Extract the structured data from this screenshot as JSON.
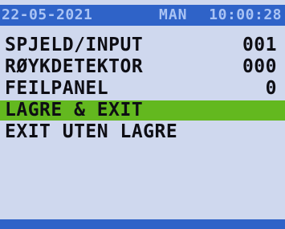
{
  "status_bar": {
    "date": "22-05-2021",
    "day": "MAN",
    "time": "10:00:28"
  },
  "menu": {
    "items": [
      {
        "label": "SPJELD/INPUT",
        "value": "001",
        "selected": false
      },
      {
        "label": "RØYKDETEKTOR",
        "value": "000",
        "selected": false
      },
      {
        "label": "FEILPANEL",
        "value": "0",
        "selected": false
      },
      {
        "label": "LAGRE & EXIT",
        "value": "",
        "selected": true
      },
      {
        "label": "EXIT UTEN LAGRE",
        "value": "",
        "selected": false
      }
    ]
  },
  "colors": {
    "screen_background": "#cfd8ee",
    "status_bar_background": "#2f63c8",
    "status_bar_text": "#a9c3f4",
    "selection_highlight": "#63b81f",
    "menu_text": "#0e0e14"
  }
}
